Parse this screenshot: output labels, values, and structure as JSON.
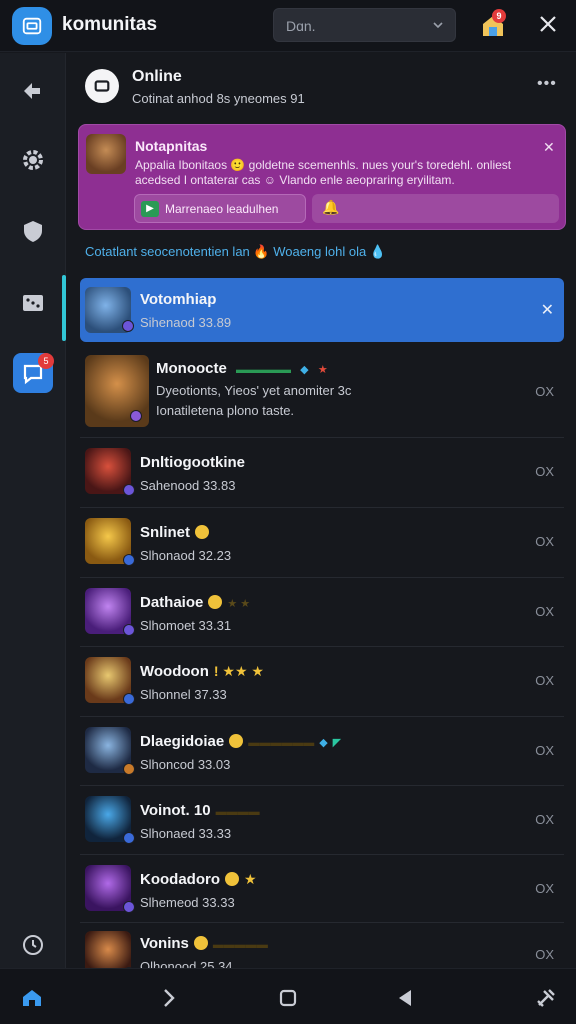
{
  "app": {
    "title": "komunitas",
    "search_value": "Dɑn.",
    "notif_count": "9"
  },
  "sidebar": {
    "items": [
      {
        "name": "back-nav",
        "icon": "back-icon"
      },
      {
        "name": "settings",
        "icon": "gear-icon"
      },
      {
        "name": "shield",
        "icon": "shield-icon"
      },
      {
        "name": "games",
        "icon": "dice-icon"
      },
      {
        "name": "chat",
        "icon": "chat-icon",
        "badge": "5"
      }
    ],
    "history_icon": "history-icon"
  },
  "header": {
    "title": "Online",
    "subtitle": "Cotinat anhod  8s  yneomes 91"
  },
  "notice": {
    "title": "Notapnitas",
    "body": "Appalia  Ibonitaos  🙂  goldetne  scemenhls.  nues  your's  toredehl. onliest  acedsed  I  ontaterar  cas  ☺  Vlando  enle  aeopraring  eryilitam.",
    "action_label": "Marrenaeo leadulhen",
    "action2_icon": "bell-icon"
  },
  "info_line": "Cotatlant  seocenotentien lan  🔥  Woaeng lohl ola  💧",
  "contacts": [
    {
      "name": "Votomhiap",
      "sub": "Sihenaod 33.89",
      "selected": true,
      "action": "✕"
    },
    {
      "name": "Monoocte",
      "sub": "Dyeotionts, Yieos' yet anomiter 3c",
      "sub2": "Ionatiletena plono taste.",
      "action": "OX",
      "tall": true
    },
    {
      "name": "Dnltiogootkine",
      "sub": "Sahenood 33.83",
      "action": "OX"
    },
    {
      "name": "Snlinet",
      "sub": "Slhonaod 32.23",
      "action": "OX"
    },
    {
      "name": "Dathaioe",
      "sub": "Slhomoet 33.31",
      "action": "OX"
    },
    {
      "name": "Woodoon",
      "sub": "Slhonnel 37.33",
      "action": "OX"
    },
    {
      "name": "Dlaegidoiae",
      "sub": "Slhoncod 33.03",
      "action": "OX"
    },
    {
      "name": "Voinot. 10",
      "sub": "Slhonaed 33.33",
      "action": "OX"
    },
    {
      "name": "Koodadoro",
      "sub": "Slhemeod 33.33",
      "action": "OX"
    },
    {
      "name": "Vonins",
      "sub": "Olhonood 25.34",
      "action": "OX"
    }
  ],
  "colors": {
    "accent": "#2f7fe0",
    "notice_bg": "#8e2f92",
    "selected_row": "#2f6fd0",
    "badge": "#e23b3b",
    "indicator": "#32c6d6"
  },
  "bottomnav": [
    {
      "name": "home",
      "icon": "home-icon"
    },
    {
      "name": "forward",
      "icon": "chevron-right-icon"
    },
    {
      "name": "square",
      "icon": "square-icon"
    },
    {
      "name": "back",
      "icon": "triangle-left-icon"
    },
    {
      "name": "tools",
      "icon": "tools-icon"
    }
  ]
}
